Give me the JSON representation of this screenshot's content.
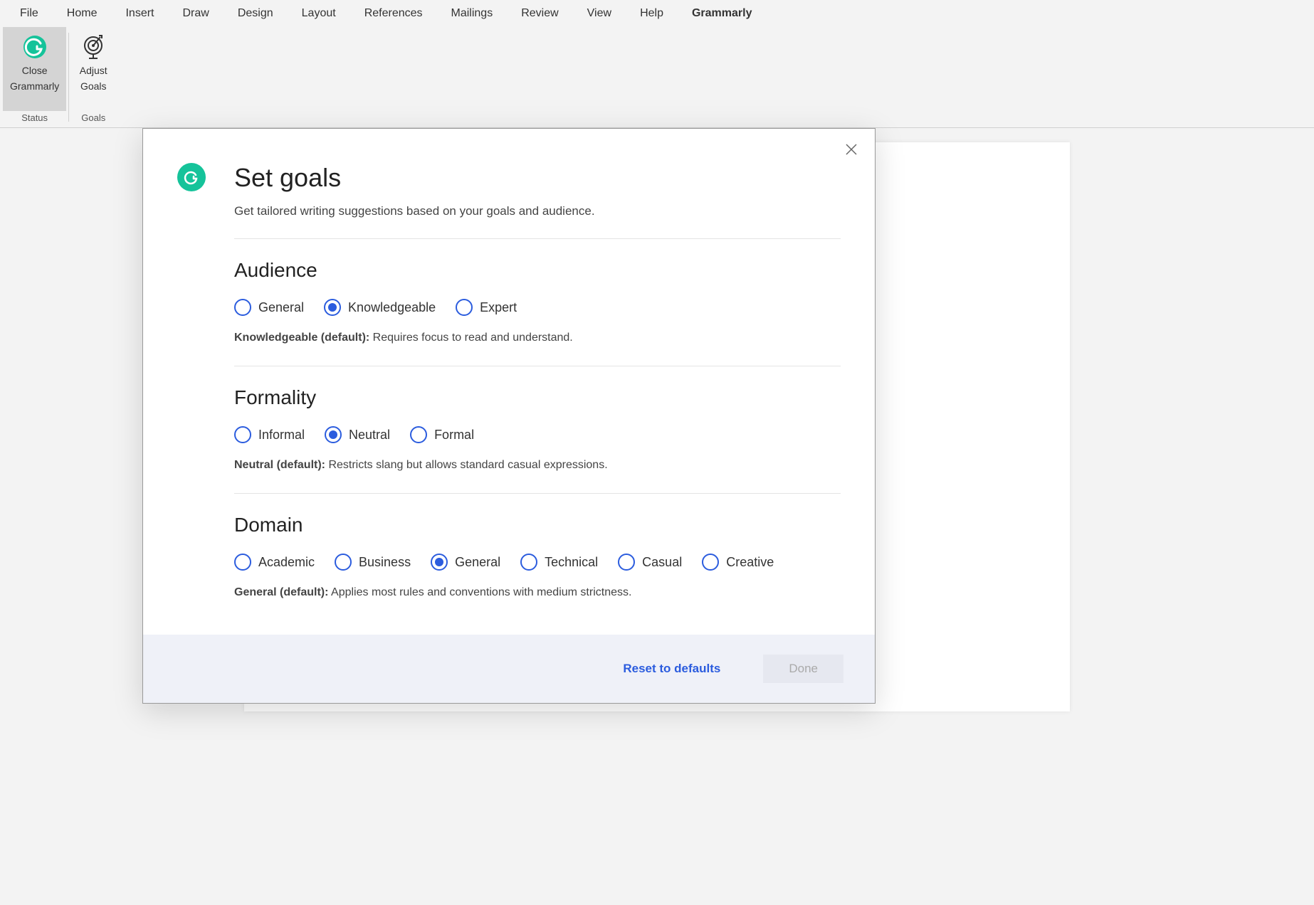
{
  "ribbon": {
    "tabs": [
      "File",
      "Home",
      "Insert",
      "Draw",
      "Design",
      "Layout",
      "References",
      "Mailings",
      "Review",
      "View",
      "Help",
      "Grammarly"
    ],
    "active_tab": "Grammarly",
    "groups": [
      {
        "label": "Status",
        "buttons": [
          {
            "name": "close-grammarly-button",
            "line1": "Close",
            "line2": "Grammarly",
            "selected": true,
            "icon": "grammarly"
          }
        ]
      },
      {
        "label": "Goals",
        "buttons": [
          {
            "name": "adjust-goals-button",
            "line1": "Adjust",
            "line2": "Goals",
            "selected": false,
            "icon": "target"
          }
        ]
      }
    ]
  },
  "modal": {
    "title": "Set goals",
    "subtitle": "Get tailored writing suggestions based on your goals and audience.",
    "sections": [
      {
        "title": "Audience",
        "options": [
          "General",
          "Knowledgeable",
          "Expert"
        ],
        "selected": "Knowledgeable",
        "desc_bold": "Knowledgeable (default):",
        "desc_rest": " Requires focus to read and understand."
      },
      {
        "title": "Formality",
        "options": [
          "Informal",
          "Neutral",
          "Formal"
        ],
        "selected": "Neutral",
        "desc_bold": "Neutral (default):",
        "desc_rest": " Restricts slang but allows standard casual expressions."
      },
      {
        "title": "Domain",
        "options": [
          "Academic",
          "Business",
          "General",
          "Technical",
          "Casual",
          "Creative"
        ],
        "selected": "General",
        "desc_bold": "General (default):",
        "desc_rest": " Applies most rules and conventions with medium strictness."
      }
    ],
    "footer": {
      "reset": "Reset to defaults",
      "done": "Done"
    }
  }
}
